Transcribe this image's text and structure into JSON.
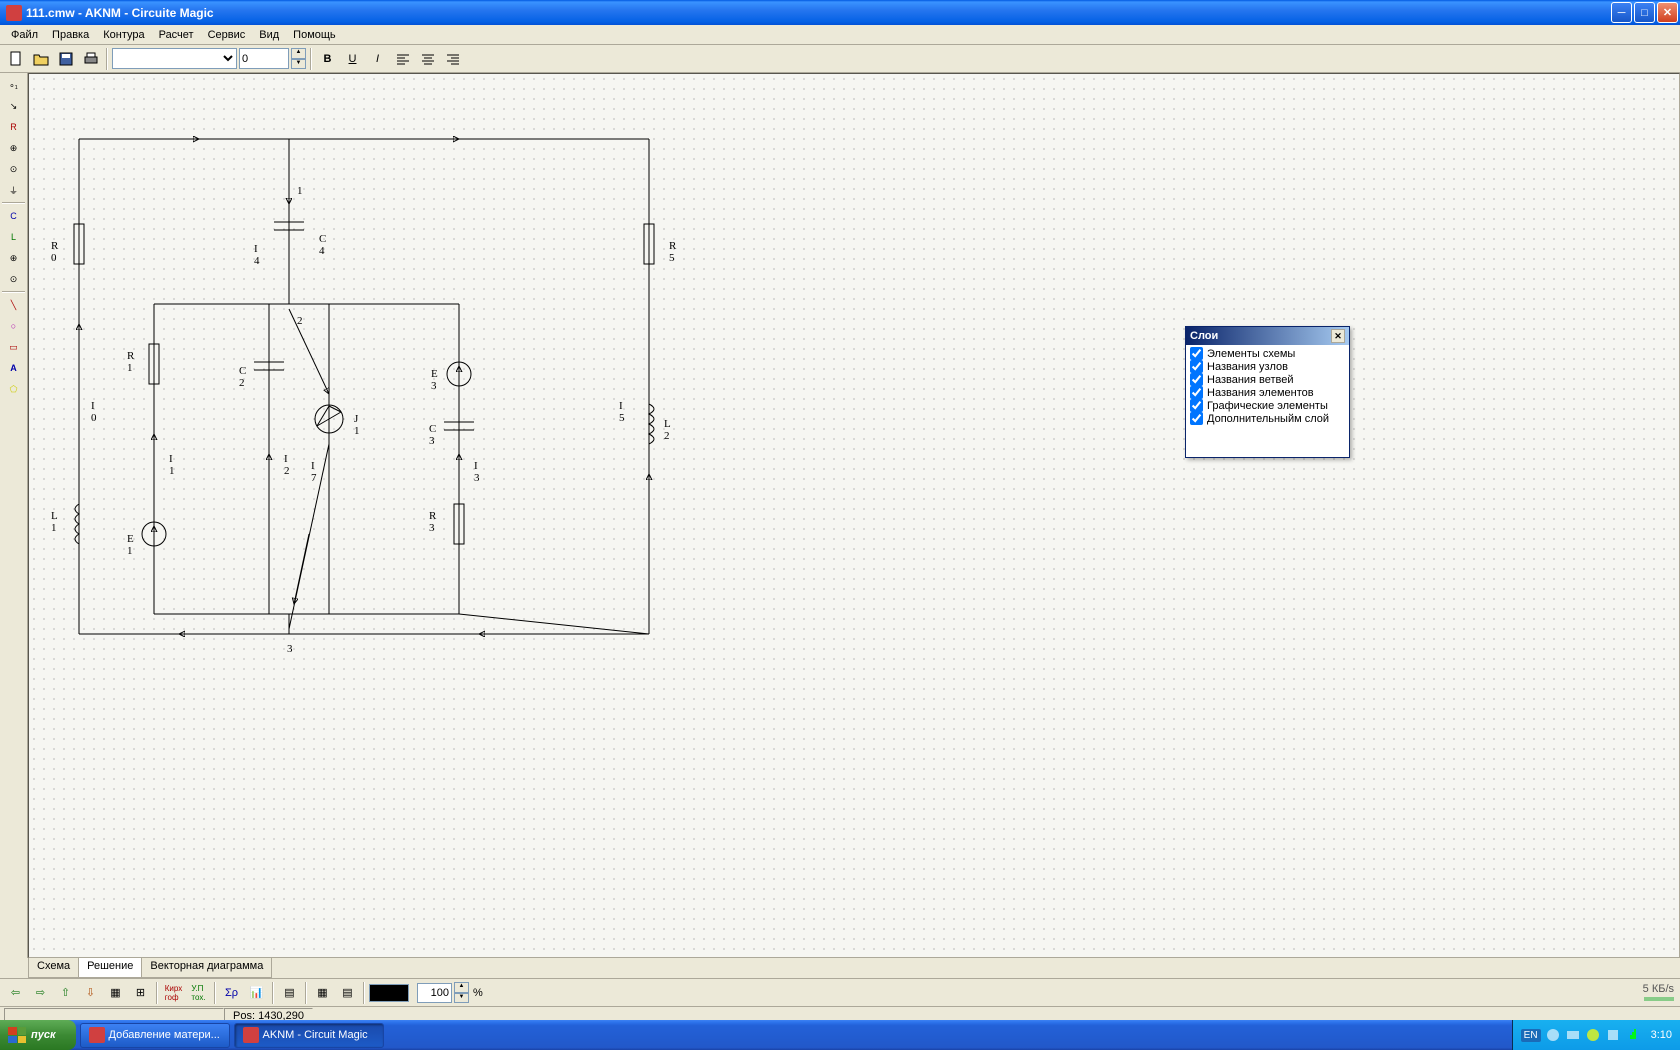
{
  "window": {
    "title": "111.cmw - AKNM - Circuite Magic"
  },
  "menu": {
    "file": "Файл",
    "edit": "Правка",
    "contours": "Контура",
    "calc": "Расчет",
    "service": "Сервис",
    "view": "Вид",
    "help": "Помощь"
  },
  "toolbar": {
    "font_size": "0"
  },
  "tabs": {
    "schema": "Схема",
    "solution": "Решение",
    "vector": "Векторная диаграмма"
  },
  "bottom": {
    "zoom": "100",
    "zoom_unit": "%"
  },
  "status": {
    "pos_label": "Pos:",
    "pos_value": "1430,290"
  },
  "layers": {
    "title": "Слои",
    "items": [
      "Элементы схемы",
      "Названия узлов",
      "Названия ветвей",
      "Названия элементов",
      "Графические элементы",
      "Дополнительныйм слой"
    ]
  },
  "circuit_labels": {
    "n1": "1",
    "n2": "2",
    "n3": "3",
    "R0": "R 0",
    "R1": "R 1",
    "R3": "R 3",
    "R5": "R 5",
    "C2": "C 2",
    "C3": "C 3",
    "C4": "C 4",
    "L1": "L 1",
    "L2": "L 2",
    "E1": "E 1",
    "E3": "E 3",
    "J1": "J 1",
    "I0": "I 0",
    "I1": "I 1",
    "I2": "I 2",
    "I3": "I 3",
    "I4": "I 4",
    "I5": "I 5",
    "I7": "I 7"
  },
  "taskbar": {
    "start": "пуск",
    "task1": "Добавление матери...",
    "task2": "AKNM - Circuit Magic",
    "lang": "EN",
    "clock": "3:10",
    "net_speed": "5 КБ/s"
  }
}
